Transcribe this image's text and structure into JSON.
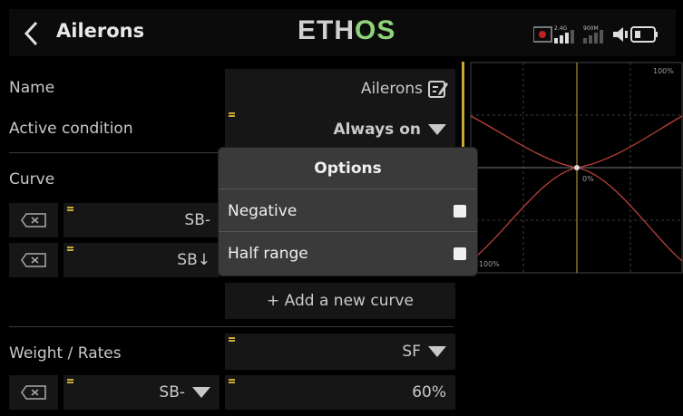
{
  "header": {
    "title": "Ailerons",
    "logo_part1": "ETH",
    "logo_part2": "OS",
    "signal_24g": "2.4G",
    "signal_900m": "900M"
  },
  "form": {
    "name_label": "Name",
    "name_value": "Ailerons",
    "active_condition_label": "Active condition",
    "active_condition_value": "Always on",
    "curve_label": "Curve",
    "curve_rows": [
      {
        "switch": "SB-"
      },
      {
        "switch": "SB↓"
      }
    ],
    "add_curve_label": "+ Add a new curve",
    "weight_label": "Weight / Rates",
    "weight_source": "SF",
    "weight_row": {
      "switch": "SB-",
      "value": "60%"
    }
  },
  "graph": {
    "top_label": "100%",
    "center_label": "0%",
    "bottom_label": "-100%"
  },
  "dialog": {
    "title": "Options",
    "options": [
      {
        "label": "Negative",
        "checked": false
      },
      {
        "label": "Half range",
        "checked": false
      }
    ]
  },
  "colors": {
    "accent_yellow": "#c9a83a",
    "logo_green": "#8fd27a",
    "curve_red": "#b8403a"
  }
}
